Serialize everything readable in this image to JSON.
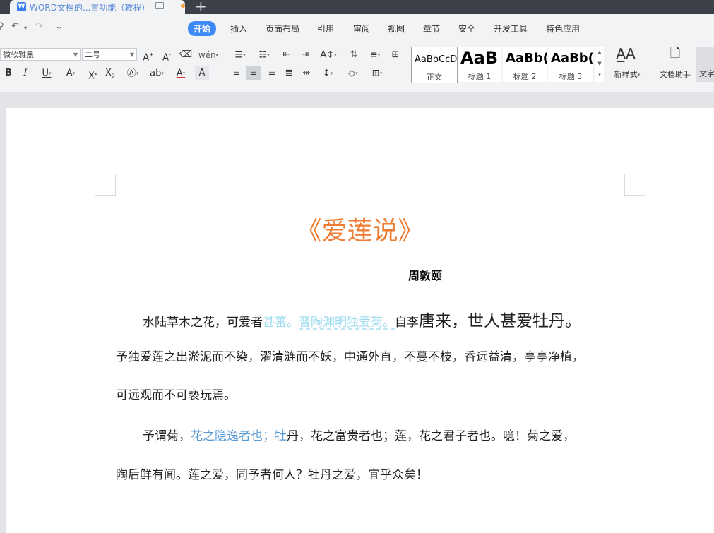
{
  "tab": {
    "icon": "W",
    "title": "WORD文档的...置功能（教程）",
    "add": "+"
  },
  "menu": {
    "items": [
      "开始",
      "插入",
      "页面布局",
      "引用",
      "审阅",
      "视图",
      "章节",
      "安全",
      "开发工具",
      "特色应用"
    ]
  },
  "quick_access": {
    "undo": "↶",
    "redo": "↷",
    "more": "⌄"
  },
  "ribbon": {
    "font_name": "微软雅黑",
    "font_size": "二号",
    "styles": [
      {
        "sample": "AaBbCcD",
        "name": "正文"
      },
      {
        "sample": "AaB",
        "name": "标题 1"
      },
      {
        "sample": "AaBb(",
        "name": "标题 2"
      },
      {
        "sample": "AaBb(",
        "name": "标题 3"
      }
    ],
    "new_style_label": "新样式",
    "doc_helper_label": "文档助手",
    "text_tool_label": "文字"
  },
  "document": {
    "title": "《爱莲说》",
    "author": "周敦颐",
    "p1": {
      "a": "水陆草木之花，可爱者",
      "b": "甚蕃。",
      "c": "晋陶渊明独爱菊。",
      "d": "自李",
      "e": "唐来，世人甚爱牡丹。"
    },
    "p2": {
      "a": "予独爱莲之出淤泥而不染，濯清涟而不妖，",
      "b": "中通外直，不蔓不枝，",
      "c": "香远益清，亭亭净植，"
    },
    "p3": "可远观而不可亵玩焉。",
    "p4": {
      "a": "予谓菊，",
      "b": "花之隐逸者也；牡",
      "c": "丹，花之富贵者也；莲，花之君子者也。噫！菊之爱，"
    },
    "p5": "陶后鲜有闻。莲之爱，同予者何人？牡丹之爱，宜乎众矣！"
  },
  "colors": {
    "title": "#ec7d33",
    "accent": "#3d8af7",
    "cyan_text": "#9fdcf0",
    "blue_text": "#5b9bd5"
  }
}
